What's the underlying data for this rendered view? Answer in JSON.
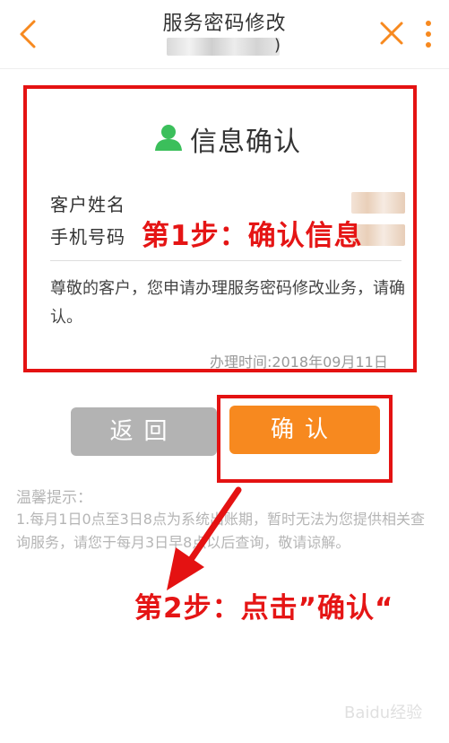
{
  "header": {
    "title": "服务密码修改",
    "subtitle_tail": ")"
  },
  "info": {
    "title": "信息确认",
    "customer_name_label": "客户姓名",
    "phone_label": "手机号码",
    "notice": "尊敬的客户，您申请办理服务密码修改业务，请确认。",
    "handle_time": "办理时间:2018年09月11日"
  },
  "buttons": {
    "return_label": "返回",
    "confirm_label": "确认"
  },
  "tips": {
    "title": "温馨提示：",
    "body": "1.每月1日0点至3日8点为系统出账期，暂时无法为您提供相关查询服务，请您于每月3日早8点以后查询，敬请谅解。"
  },
  "annotations": {
    "step1": "第1步：确认信息",
    "step2": "第2步：点击”确认“"
  },
  "watermark": "Baidu经验",
  "colors": {
    "accent": "#f7891f",
    "annotation_red": "#e41212",
    "user_icon_green": "#3bbf5b"
  },
  "icons": [
    "back-arrow-icon",
    "close-icon",
    "more-vertical-icon",
    "user-icon"
  ]
}
